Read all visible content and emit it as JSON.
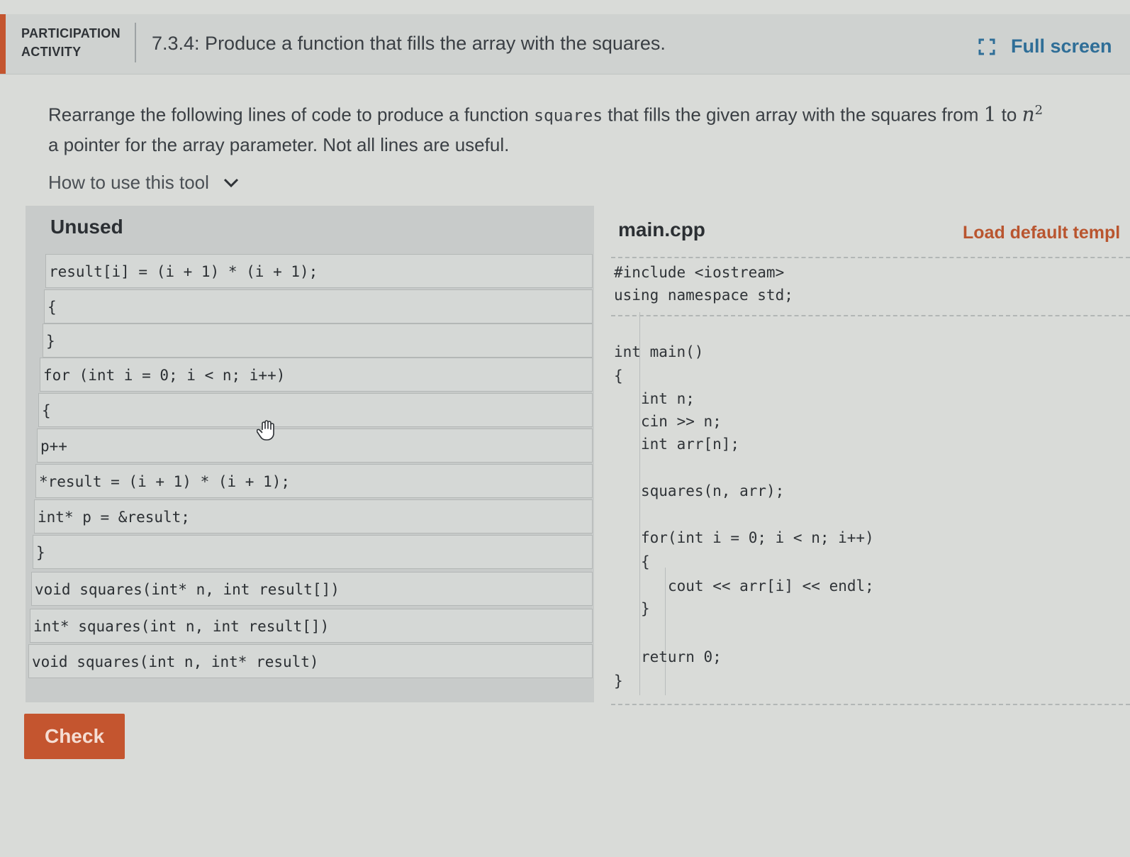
{
  "header": {
    "activity_label": "PARTICIPATION ACTIVITY",
    "title": "7.3.4: Produce a function that fills the array with the squares.",
    "fullscreen_label": "Full screen",
    "accent_color": "#c4552f"
  },
  "instructions": {
    "part1": "Rearrange the following lines of code to produce a function ",
    "code_word": "squares",
    "part2": " that fills the given array with the squares from ",
    "math_from": "1",
    "part3": " to ",
    "math_to": "n",
    "math_exp": "2",
    "line2": "a pointer for the array parameter. Not all lines are useful."
  },
  "howto": {
    "label": "How to use this tool"
  },
  "unused": {
    "title": "Unused",
    "blocks": [
      "result[i] = (i + 1) * (i + 1);",
      "{",
      "}",
      "for (int i = 0; i < n; i++)",
      "{",
      "p++",
      "*result = (i + 1) * (i + 1);",
      "int* p = &result;",
      "}",
      "void squares(int* n, int result[])",
      "int* squares(int n, int result[])",
      "void squares(int n, int* result)"
    ]
  },
  "editor": {
    "filename": "main.cpp",
    "load_default_label": "Load default templ",
    "lines": [
      "#include <iostream>",
      "using namespace std;",
      "int main()",
      "{",
      "int n;",
      "cin >> n;",
      "int arr[n];",
      "squares(n, arr);",
      "for(int i = 0; i < n; i++)",
      "{",
      "cout << arr[i] << endl;",
      "}",
      "return 0;",
      "}"
    ]
  },
  "check_label": "Check"
}
